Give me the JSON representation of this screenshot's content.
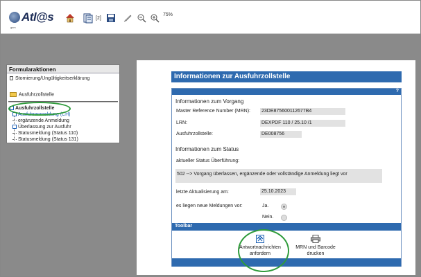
{
  "app": {
    "logo_text": "Atl@s",
    "logo_sub": "gsm",
    "toolbar_badge": "[2]",
    "zoom_label": "75%",
    "icons": [
      "home-icon",
      "document-list-icon",
      "save-icon",
      "pen-icon",
      "zoom-out-icon",
      "zoom-in-icon"
    ]
  },
  "nav": {
    "title": "Formularaktionen",
    "action_storno": "Stornierung/Ungültigkeitserklärung",
    "folder_label": "Ausfuhrzollstelle",
    "tree": {
      "root": "Ausfuhrzollstelle",
      "items": [
        "Ausfuhranmeldung (CH)",
        "ergänzende Anmeldung",
        "Überlassung zur Ausfuhr",
        "Statusmeldung (Status 110)",
        "Statusmeldung (Status 131)"
      ]
    }
  },
  "form": {
    "title": "Informationen zur Ausfuhrzollstelle",
    "help": "?",
    "vorgang_heading": "Informationen zum Vorgang",
    "mrn_label": "Master Reference Number (MRN):",
    "mrn_value": "23DE875600112677B4",
    "lrn_label": "LRN:",
    "lrn_value": "DEXPDF 110 / 25.10 /1",
    "zollstelle_label": "Ausfuhrzollstelle:",
    "zollstelle_value": "DE008756",
    "status_heading": "Informationen zum Status",
    "status_label": "aktueller Status Überführung:",
    "status_value": "502 --> Vorgang überlassen, ergänzende oder vollständige Anmeldung liegt vor",
    "update_label": "letzte Aktualisierung am:",
    "update_value": "25.10.2023",
    "messages_label": "es liegen neue Meldungen vor:",
    "yes_label": "Ja.",
    "no_label": "Nein.",
    "toolbar_label": "Toolbar",
    "btn_request_line1": "Antwortnachrichten",
    "btn_request_line2": "anfordern",
    "btn_print_line1": "MRN und Barcode",
    "btn_print_line2": "drucken"
  },
  "colors": {
    "accent_blue": "#2e6aaf",
    "highlight_green": "#2e9b3a",
    "desktop_grey": "#8a8a8a"
  }
}
